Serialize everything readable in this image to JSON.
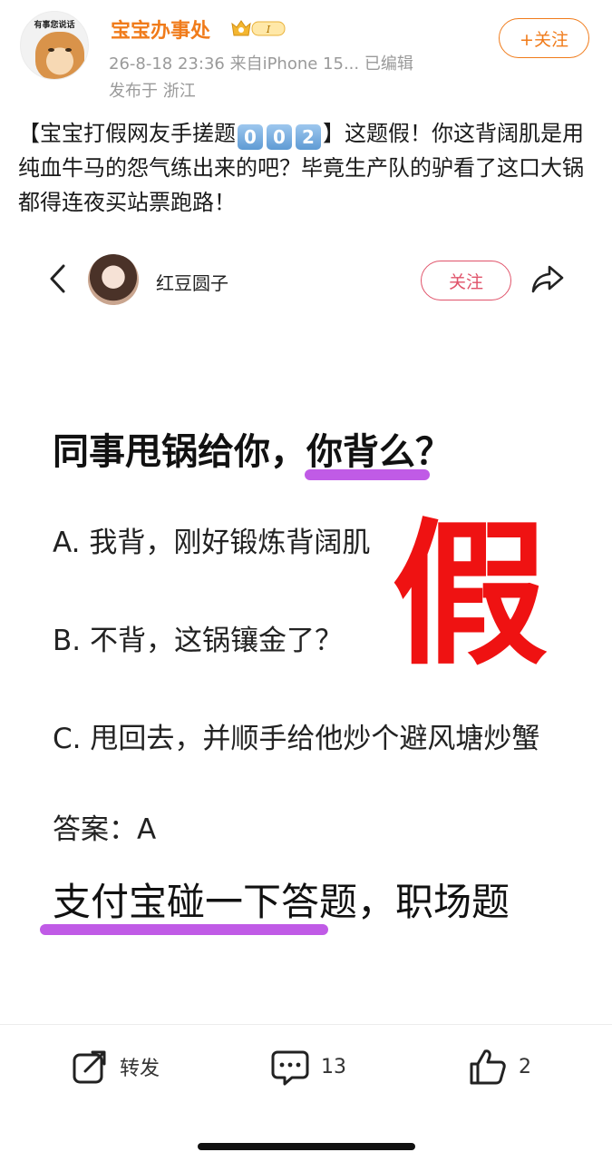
{
  "header": {
    "avatar_caption": "有事您说话",
    "username": "宝宝办事处",
    "vip_label": "I",
    "timestamp_source": "26-8-18 23:36  来自iPhone 15...  已编辑",
    "location": "发布于 浙江",
    "follow_label": "+关注"
  },
  "post": {
    "bracket_open": "【宝宝打假网友手搓题",
    "badge1": "0",
    "badge2": "0",
    "badge3": "2",
    "text_rest": "】这题假！你这背阔肌是用纯血牛马的怨气练出来的吧？毕竟生产队的驴看了这口大锅都得连夜买站票跑路！"
  },
  "embed": {
    "author": "红豆圆子",
    "follow_label": "关注",
    "question": "同事甩锅给你，你背么？",
    "option_a": "A. 我背，刚好锻炼背阔肌",
    "option_b": "B. 不背，这锅镶金了？",
    "option_c": "C. 甩回去，并顺手给他炒个避风塘炒蟹",
    "answer": "答案：A",
    "fake_stamp": "假",
    "footer_line": "支付宝碰一下答题，职场题"
  },
  "actions": {
    "repost_label": "转发",
    "comment_count": "13",
    "like_count": "2"
  },
  "colors": {
    "username": "#f07b1a",
    "stamp": "#ef1212",
    "highlight": "#c05be6",
    "embed_follow": "#e0536a"
  }
}
